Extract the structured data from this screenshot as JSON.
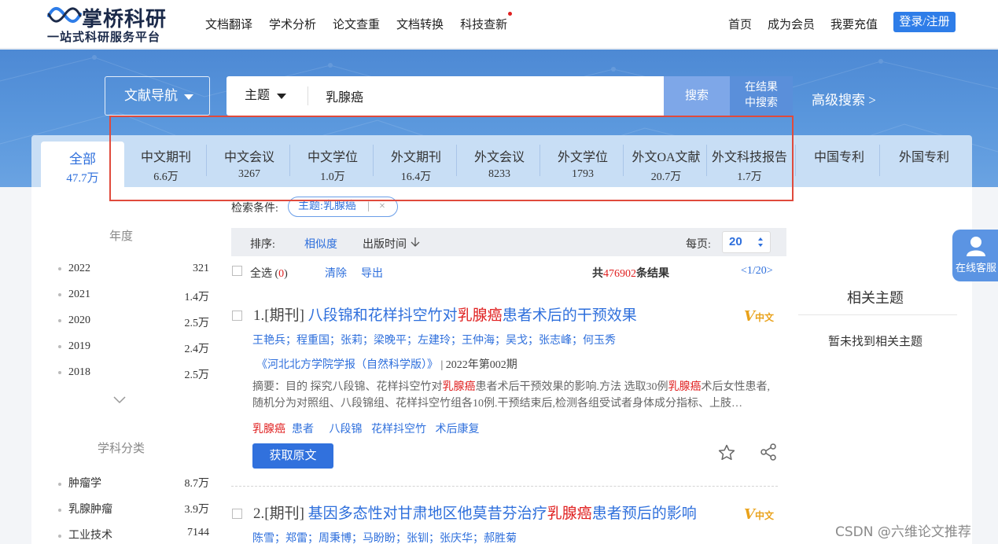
{
  "header": {
    "logo_title": "掌桥科研",
    "logo_subtitle": "一站式科研服务平台",
    "nav": [
      "文档翻译",
      "学术分析",
      "论文查重",
      "文档转换",
      "科技查新"
    ],
    "top_right": [
      "首页",
      "成为会员",
      "我要充值"
    ],
    "login": "登录/注册"
  },
  "search": {
    "doc_nav": "文献导航",
    "scope": "主题",
    "query": "乳腺癌",
    "search_btn": "搜索",
    "in_result_line1": "在结果",
    "in_result_line2": "中搜索",
    "advanced": "高级搜索 >"
  },
  "tabs": [
    {
      "label": "全部",
      "count": "47.7万"
    },
    {
      "label": "中文期刊",
      "count": "6.6万"
    },
    {
      "label": "中文会议",
      "count": "3267"
    },
    {
      "label": "中文学位",
      "count": "1.0万"
    },
    {
      "label": "外文期刊",
      "count": "16.4万"
    },
    {
      "label": "外文会议",
      "count": "8233"
    },
    {
      "label": "外文学位",
      "count": "1793"
    },
    {
      "label": "外文OA文献",
      "count": "20.7万"
    },
    {
      "label": "外文科技报告",
      "count": "1.7万"
    },
    {
      "label": "中国专利",
      "count": ""
    },
    {
      "label": "外国专利",
      "count": ""
    }
  ],
  "sidebar": {
    "year_title": "年度",
    "years": [
      {
        "label": "2022",
        "count": "321"
      },
      {
        "label": "2021",
        "count": "1.4万"
      },
      {
        "label": "2020",
        "count": "2.5万"
      },
      {
        "label": "2019",
        "count": "2.4万"
      },
      {
        "label": "2018",
        "count": "2.5万"
      }
    ],
    "subject_title": "学科分类",
    "subjects": [
      {
        "label": "肿瘤学",
        "count": "8.7万"
      },
      {
        "label": "乳腺肿瘤",
        "count": "3.9万"
      },
      {
        "label": "工业技术",
        "count": "7144"
      }
    ]
  },
  "results_header": {
    "conditions_label": "检索条件:",
    "condition_chip": "主题:乳腺癌",
    "chip_bar": "|",
    "chip_close": "×",
    "sort_label": "排序:",
    "sort_relevance": "相似度",
    "sort_date": "出版时间",
    "per_page_label": "每页:",
    "per_page_value": "20",
    "select_all": "全选",
    "selected_count": "0",
    "clear": "清除",
    "export": "导出",
    "total_prefix": "共",
    "total_count": "476902",
    "total_suffix": "条结果",
    "page_prefix": "<",
    "page_current": "1",
    "page_sep": "/",
    "page_total": "20",
    "page_suffix": ">"
  },
  "results": [
    {
      "index": "1.",
      "type": "[期刊]",
      "title_before": "八段锦和花样抖空竹对",
      "title_highlight": "乳腺癌",
      "title_after": "患者术后的干预效果",
      "badge_v": "V",
      "badge_label": "中文",
      "authors": "王艳兵；程重国；张莉；梁晚平；左建玲；王仲海；吴戈；张志峰；何玉秀",
      "source": "《河北北方学院学报（自然科学版）》",
      "year": "| 2022年第002期",
      "abstract_a": "摘要：目的 探究八段锦、花样抖空竹对",
      "abstract_hl1": "乳腺癌",
      "abstract_b": "患者术后干预效果的影响.方法 选取30例",
      "abstract_hl2": "乳腺癌",
      "abstract_c": "术后女性患者,随机分为对照组、八段锦组、花样抖空竹组各10例.干预结束后,检测各组受试者身体成分指标、上肢…",
      "keyword1_hl": "乳腺癌",
      "keyword1_rest": "患者",
      "keyword2": "八段锦",
      "keyword3": "花样抖空竹",
      "keyword4": "术后康复",
      "action": "获取原文"
    },
    {
      "index": "2.",
      "type": "[期刊]",
      "title_before": "基因多态性对甘肃地区他莫昔芬治疗",
      "title_highlight": "乳腺癌",
      "title_after": "患者预后的影响",
      "badge_v": "V",
      "badge_label": "中文",
      "authors": "陈雪；郑雷；周秉博；马盼盼；张钏；张庆华；郝胜菊"
    }
  ],
  "related": {
    "title": "相关主题",
    "empty": "暂未找到相关主题"
  },
  "kefu": "在线客服",
  "watermark": "CSDN @六维论文推荐",
  "colors": {
    "accent": "#2e6fdc",
    "highlight": "#e02020",
    "hero": "#5b98dd",
    "frame": "#e04a3c"
  }
}
